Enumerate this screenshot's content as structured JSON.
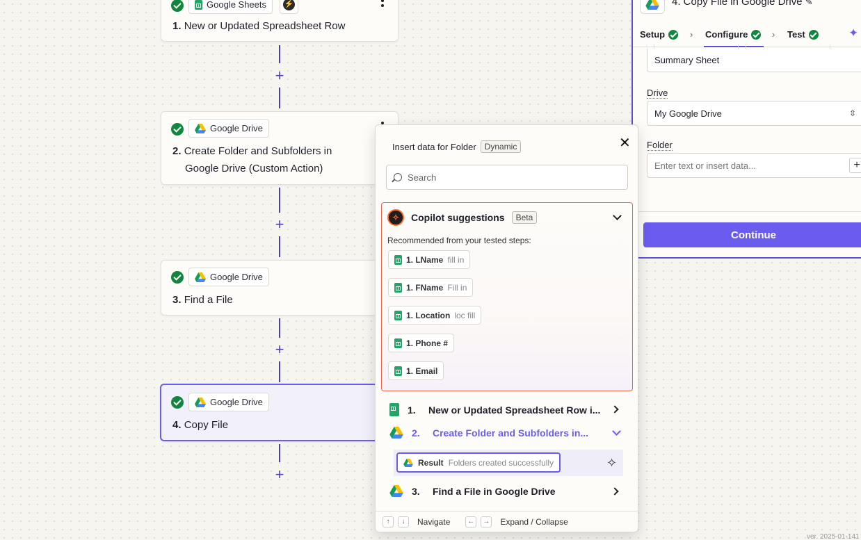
{
  "canvas": {
    "steps": [
      {
        "app": "Google Sheets",
        "number": "1.",
        "title": "New or Updated Spreadsheet Row"
      },
      {
        "app": "Google Drive",
        "number": "2.",
        "title_line1": "Create Folder and Subfolders in",
        "title_line2": "Google Drive (Custom Action)"
      },
      {
        "app": "Google Drive",
        "number": "3.",
        "title": "Find a File"
      },
      {
        "app": "Google Drive",
        "number": "4.",
        "title": "Copy File"
      }
    ],
    "plus_symbol": "+"
  },
  "panel": {
    "title": "4. Copy File in Google Drive",
    "tabs": [
      {
        "label": "Setup"
      },
      {
        "label": "Configure"
      },
      {
        "label": "Test"
      }
    ],
    "summary_value": "Summary Sheet",
    "drive_label": "Drive",
    "drive_value": "My Google Drive",
    "folder_label": "Folder",
    "folder_placeholder": "Enter text or insert data...",
    "continue_label": "Continue"
  },
  "popup": {
    "title": "Insert data for Folder",
    "badge": "Dynamic",
    "search_placeholder": "Search",
    "copilot_title": "Copilot suggestions",
    "copilot_badge": "Beta",
    "recommend_text": "Recommended from your tested steps:",
    "suggestions": [
      {
        "label": "1. LName",
        "hint": "fill in"
      },
      {
        "label": "1. FName",
        "hint": "Fill in"
      },
      {
        "label": "1. Location",
        "hint": "loc fill"
      },
      {
        "label": "1. Phone #",
        "hint": ""
      },
      {
        "label": "1. Email",
        "hint": ""
      }
    ],
    "groups": [
      {
        "num": "1.",
        "label": "New or Updated Spreadsheet Row i..."
      },
      {
        "num": "2.",
        "label": "Create Folder and Subfolders in..."
      },
      {
        "num": "3.",
        "label": "Find a File in Google Drive"
      }
    ],
    "result": {
      "label": "Result",
      "value": "Folders created successfully"
    },
    "footer": {
      "navigate": "Navigate",
      "expand": "Expand / Collapse",
      "up": "↑",
      "down": "↓",
      "left": "←",
      "right": "→"
    }
  },
  "version": "ver. 2025-01-141",
  "colors": {
    "accent": "#6b5cf0",
    "success": "#12863e",
    "copilot_border": "#e56a4a"
  }
}
